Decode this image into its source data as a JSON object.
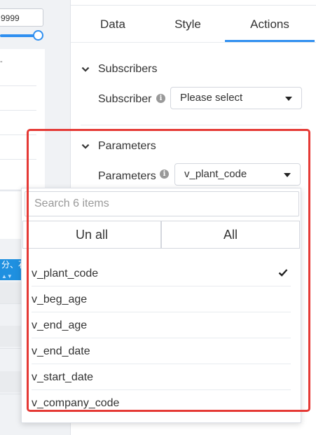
{
  "left_partial": {
    "input_value": "9999",
    "axis_tick": "-",
    "column_header": "分、石"
  },
  "tabs": [
    {
      "label": "Data",
      "active": false
    },
    {
      "label": "Style",
      "active": false
    },
    {
      "label": "Actions",
      "active": true
    }
  ],
  "subscribers": {
    "section_title": "Subscribers",
    "field_label": "Subscriber",
    "select_value": "Please select"
  },
  "parameters": {
    "section_title": "Parameters",
    "field_label": "Parameters",
    "select_value": "v_plant_code"
  },
  "dropdown": {
    "search_placeholder": "Search 6 items",
    "unselect_all_label": "Un all",
    "select_all_label": "All",
    "items": [
      {
        "label": "v_plant_code",
        "checked": true
      },
      {
        "label": "v_beg_age",
        "checked": false
      },
      {
        "label": "v_end_age",
        "checked": false
      },
      {
        "label": "v_end_date",
        "checked": false
      },
      {
        "label": "v_start_date",
        "checked": false
      },
      {
        "label": "v_company_code",
        "checked": false
      }
    ]
  },
  "colors": {
    "accent": "#2f8ff0",
    "highlight": "#e53935"
  }
}
